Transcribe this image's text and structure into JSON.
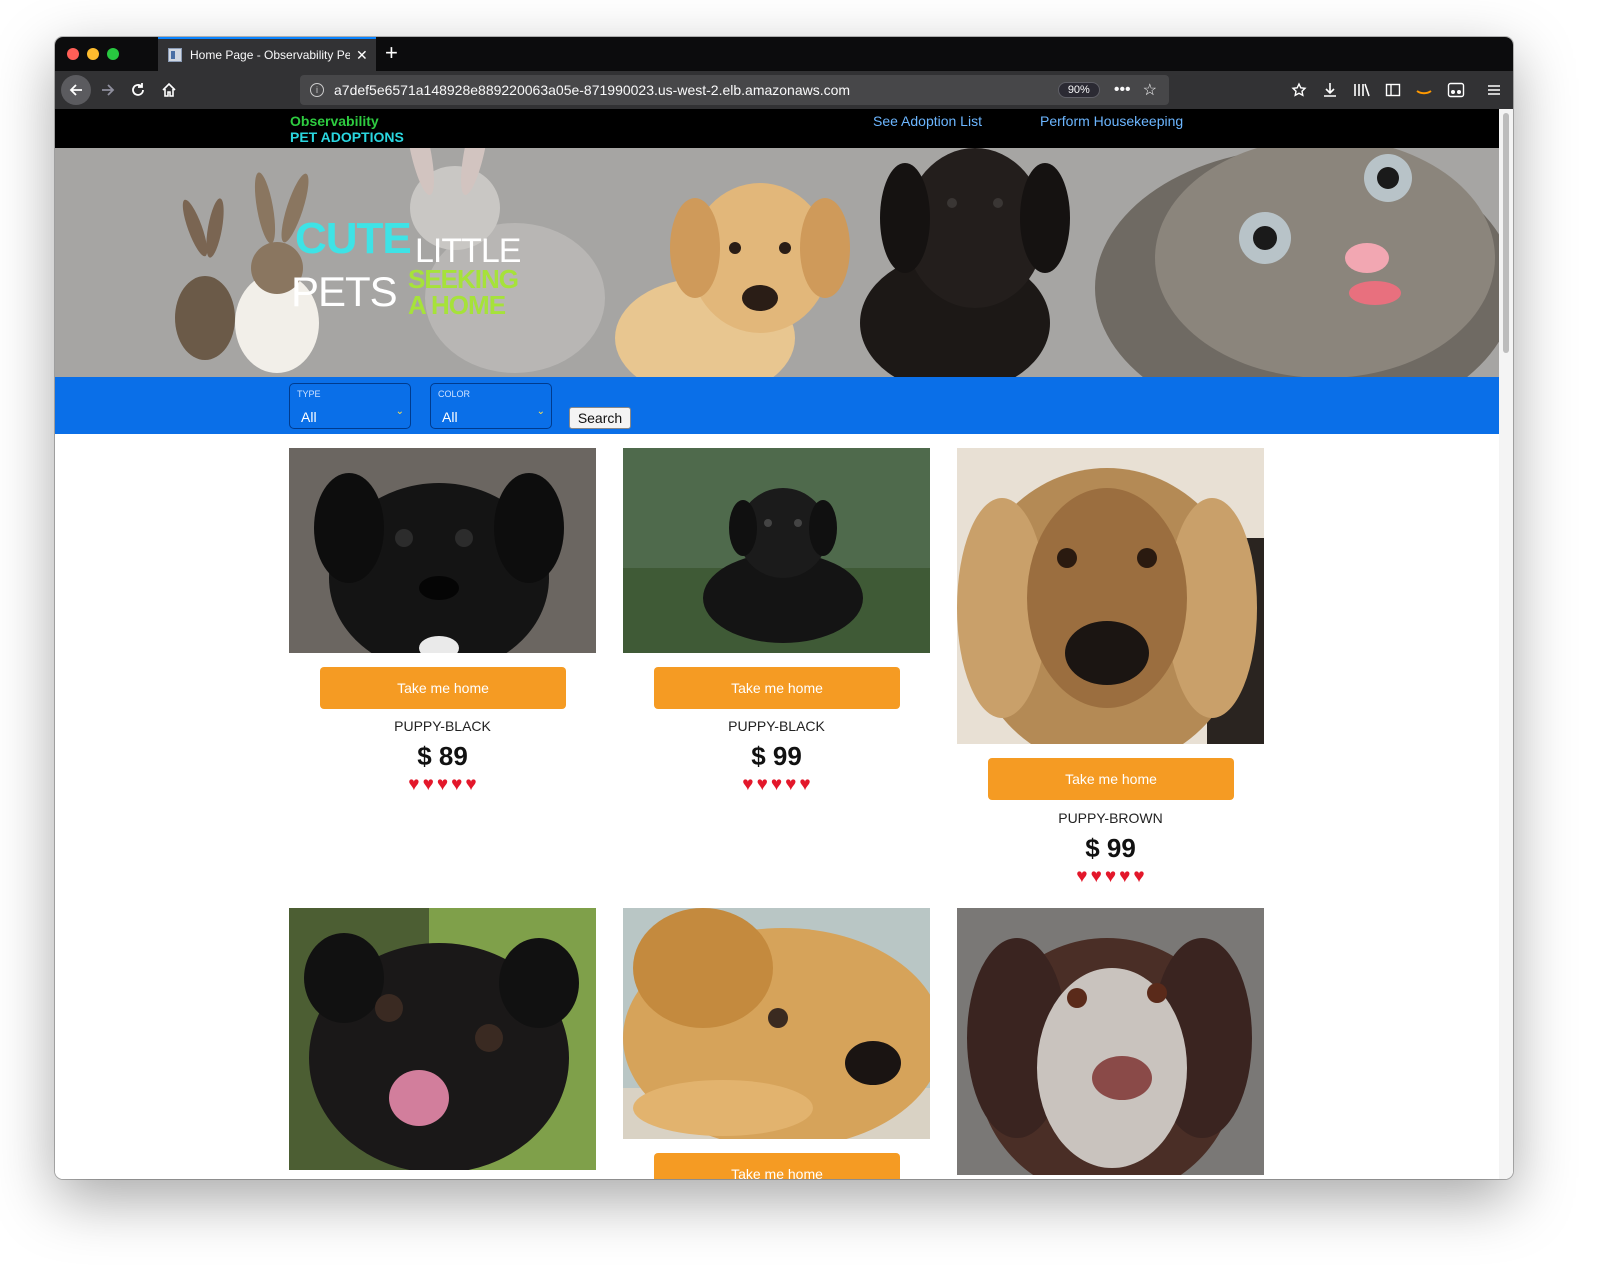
{
  "browser": {
    "tab_title": "Home Page - Observability Pet",
    "tab_close": "✕",
    "new_tab": "+",
    "url": "a7def5e6571a148928e889220063a05e-871990023.us-west-2.elb.amazonaws.com",
    "zoom": "90%",
    "url_more": "•••",
    "url_bookmark": "☆"
  },
  "site": {
    "brand_line1": "Observability",
    "brand_line2": "PET ADOPTIONS",
    "nav": [
      "See Adoption List",
      "Perform Housekeeping"
    ]
  },
  "banner": {
    "word1": "CUTE",
    "word2": "LITTLE",
    "word3": "PETS",
    "word4": "SEEKING",
    "word5": "A HOME"
  },
  "filters": {
    "type_label": "TYPE",
    "type_value": "All",
    "color_label": "COLOR",
    "color_value": "All",
    "search_label": "Search"
  },
  "pets": [
    {
      "name": "PUPPY-BLACK",
      "price": "$ 89",
      "button": "Take me home",
      "hearts": 5
    },
    {
      "name": "PUPPY-BLACK",
      "price": "$ 99",
      "button": "Take me home",
      "hearts": 5
    },
    {
      "name": "PUPPY-BROWN",
      "price": "$ 99",
      "button": "Take me home",
      "hearts": 5
    },
    {
      "name": "",
      "price": "",
      "button": "",
      "hearts": 0
    },
    {
      "name": "",
      "price": "",
      "button": "Take me home",
      "hearts": 0
    },
    {
      "name": "",
      "price": "",
      "button": "",
      "hearts": 0
    }
  ],
  "colors": {
    "accent_blue": "#0a6fe8",
    "button_orange": "#f59b23",
    "brand_green": "#2ecc40",
    "brand_cyan": "#2ad7e0",
    "link_blue": "#6cb6ff",
    "heart_red": "#e3172a"
  }
}
